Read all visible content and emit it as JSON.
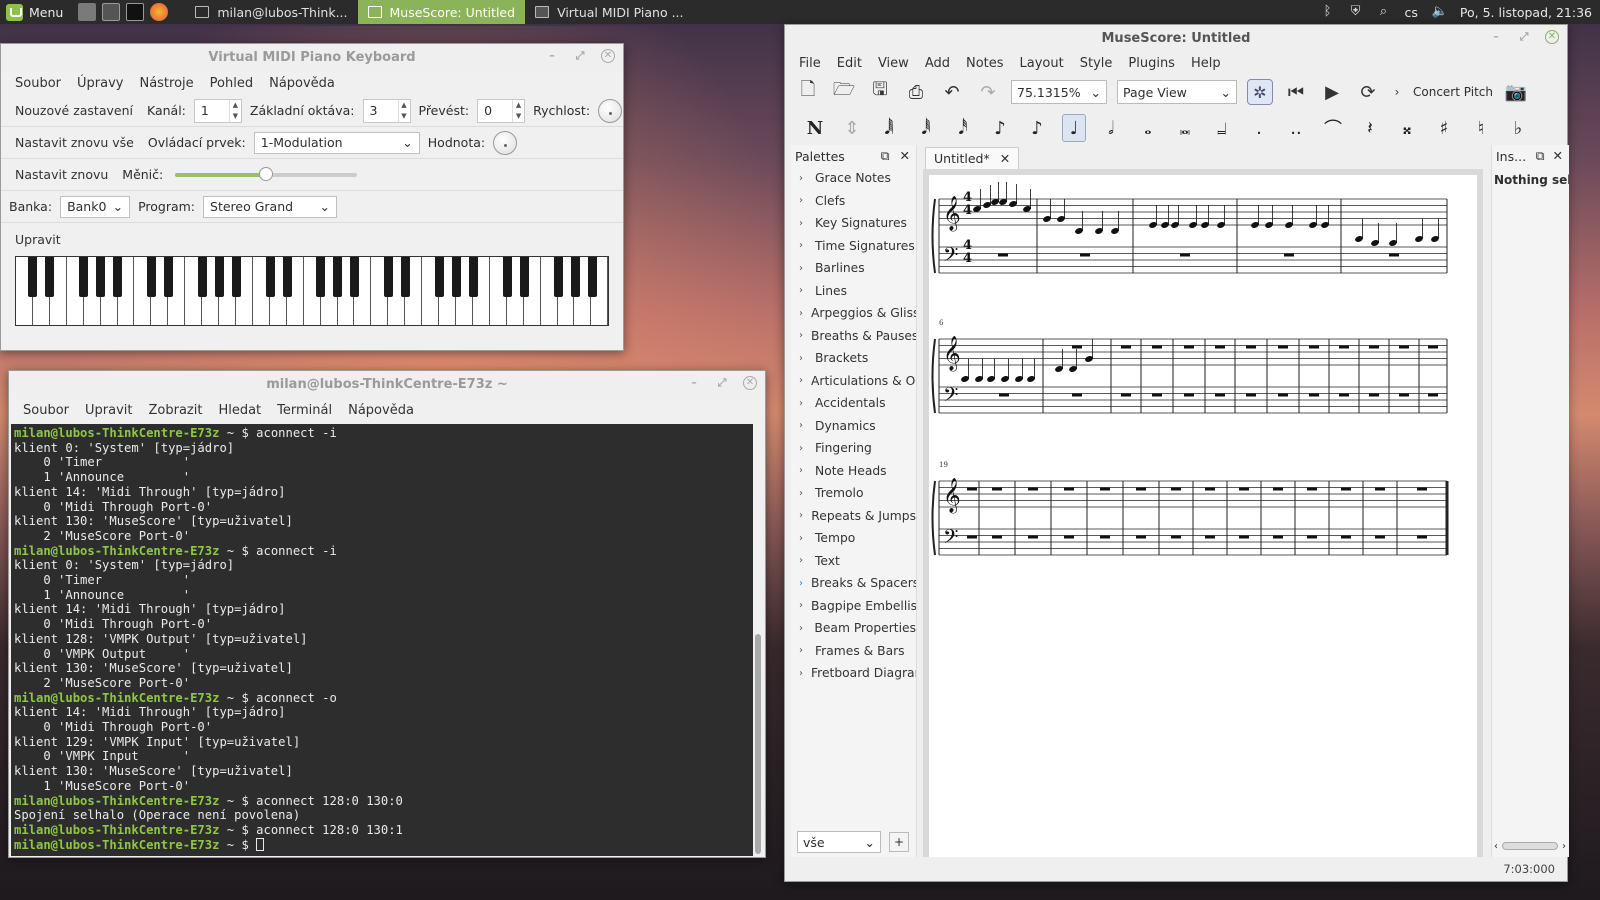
{
  "taskbar": {
    "menu_label": "Menu",
    "tasks": [
      {
        "label": "milan@lubos-Think..."
      },
      {
        "label": "MuseScore: Untitled"
      },
      {
        "label": "Virtual MIDI Piano ..."
      }
    ],
    "keyboard_layout": "cs",
    "clock": "Po,  5. listopad, 21:36"
  },
  "vmpk": {
    "title": "Virtual MIDI Piano Keyboard",
    "menu": [
      "Soubor",
      "Úpravy",
      "Nástroje",
      "Pohled",
      "Nápověda"
    ],
    "note_stop_label": "Nouzové zastavení",
    "channel_label": "Kanál:",
    "channel_value": "1",
    "base_octave_label": "Základní oktáva:",
    "base_octave_value": "3",
    "transpose_label": "Převést:",
    "transpose_value": "0",
    "velocity_label": "Rychlost:",
    "reset_all_label": "Nastavit znovu vše",
    "control_label": "Ovládací prvek:",
    "control_value": "1-Modulation",
    "value_label": "Hodnota:",
    "reset_label": "Nastavit znovu",
    "bender_label": "Měnič:",
    "bender_level": 0.5,
    "bank_label": "Banka:",
    "bank_value": "Bank0",
    "program_label": "Program:",
    "program_value": "Stereo Grand",
    "edit_label": "Upravit"
  },
  "terminal": {
    "title": "milan@lubos-ThinkCentre-E73z ~",
    "menu": [
      "Soubor",
      "Upravit",
      "Zobrazit",
      "Hledat",
      "Terminál",
      "Nápověda"
    ],
    "lines": [
      {
        "prompt": "milan@lubos-ThinkCentre-E73z",
        "cmd": " ~ $ aconnect -i"
      },
      {
        "text": "klient 0: 'System' [typ=jádro]"
      },
      {
        "text": "    0 'Timer           '"
      },
      {
        "text": "    1 'Announce        '"
      },
      {
        "text": "klient 14: 'Midi Through' [typ=jádro]"
      },
      {
        "text": "    0 'Midi Through Port-0'"
      },
      {
        "text": "klient 130: 'MuseScore' [typ=uživatel]"
      },
      {
        "text": "    2 'MuseScore Port-0'"
      },
      {
        "prompt": "milan@lubos-ThinkCentre-E73z",
        "cmd": " ~ $ aconnect -i"
      },
      {
        "text": "klient 0: 'System' [typ=jádro]"
      },
      {
        "text": "    0 'Timer           '"
      },
      {
        "text": "    1 'Announce        '"
      },
      {
        "text": "klient 14: 'Midi Through' [typ=jádro]"
      },
      {
        "text": "    0 'Midi Through Port-0'"
      },
      {
        "text": "klient 128: 'VMPK Output' [typ=uživatel]"
      },
      {
        "text": "    0 'VMPK Output     '"
      },
      {
        "text": "klient 130: 'MuseScore' [typ=uživatel]"
      },
      {
        "text": "    2 'MuseScore Port-0'"
      },
      {
        "prompt": "milan@lubos-ThinkCentre-E73z",
        "cmd": " ~ $ aconnect -o"
      },
      {
        "text": "klient 14: 'Midi Through' [typ=jádro]"
      },
      {
        "text": "    0 'Midi Through Port-0'"
      },
      {
        "text": "klient 129: 'VMPK Input' [typ=uživatel]"
      },
      {
        "text": "    0 'VMPK Input      '"
      },
      {
        "text": "klient 130: 'MuseScore' [typ=uživatel]"
      },
      {
        "text": "    1 'MuseScore Port-0'"
      },
      {
        "prompt": "milan@lubos-ThinkCentre-E73z",
        "cmd": " ~ $ aconnect 128:0 130:0"
      },
      {
        "text": "Spojení selhalo (Operace není povolena)"
      },
      {
        "prompt": "milan@lubos-ThinkCentre-E73z",
        "cmd": " ~ $ aconnect 128:0 130:1"
      },
      {
        "prompt": "milan@lubos-ThinkCentre-E73z",
        "cmd": " ~ $ ",
        "cursor": true
      }
    ]
  },
  "musescore": {
    "title": "MuseScore: Untitled",
    "menu": [
      "File",
      "Edit",
      "View",
      "Add",
      "Notes",
      "Layout",
      "Style",
      "Plugins",
      "Help"
    ],
    "zoom": "75.1315%",
    "view_mode": "Page View",
    "concert_pitch": "Concert Pitch",
    "palettes_title": "Palettes",
    "palettes": [
      "Grace Notes",
      "Clefs",
      "Key Signatures",
      "Time Signatures",
      "Barlines",
      "Lines",
      "Arpeggios & Glissandos",
      "Breaths & Pauses",
      "Brackets",
      "Articulations & Ornaments",
      "Accidentals",
      "Dynamics",
      "Fingering",
      "Note Heads",
      "Tremolo",
      "Repeats & Jumps",
      "Tempo",
      "Text",
      "Breaks & Spacers",
      "Bagpipe Embellishments",
      "Beam Properties",
      "Frames & Bars",
      "Fretboard Diagrams"
    ],
    "palette_workspace": "vše",
    "score_tab": "Untitled*",
    "inspector_title": "Ins...",
    "inspector_text": "Nothing sele",
    "measure_numbers": [
      "6",
      "19"
    ],
    "time_signature": "4/4",
    "status_time": "7:03:000"
  }
}
